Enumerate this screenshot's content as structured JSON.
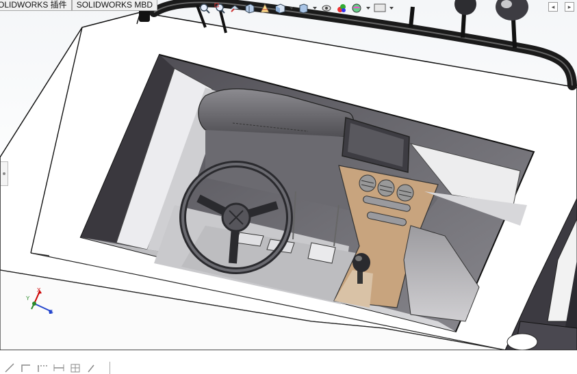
{
  "tabs": [
    {
      "label": "OLIDWORKS 插件"
    },
    {
      "label": "SOLIDWORKS MBD"
    }
  ],
  "hud_icons": [
    "zoom-to-fit-icon",
    "zoom-area-icon",
    "previous-view-icon",
    "section-view-icon",
    "dynamic-annotation-icon",
    "view-orientation-icon",
    "display-style-icon",
    "hide-show-items-icon",
    "edit-appearance-icon",
    "apply-scene-icon",
    "view-settings-icon"
  ],
  "corner_buttons": {
    "left": "◂",
    "right": "▸"
  },
  "axes": {
    "x": "X",
    "y": "Y",
    "z": "Z"
  },
  "colors": {
    "body_white": "#ffffff",
    "cabin_dark": "#5a5860",
    "console_tan": "#c8a47e",
    "frame_black": "#2a2a2a",
    "axis_x": "#cc0000",
    "axis_y": "#2a8a2a",
    "axis_z": "#2244cc"
  },
  "status_tools": [
    "line-tool-icon",
    "rectangle-tool-icon",
    "dotted-line-icon",
    "dimension-icon",
    "grid-icon",
    "arc-tool-icon"
  ]
}
